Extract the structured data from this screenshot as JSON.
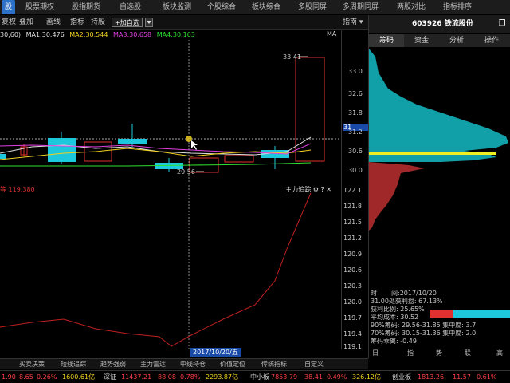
{
  "topnav": {
    "tabs": [
      "股",
      "股票期权",
      "股指期货",
      "自选股",
      "板块监测",
      "个股综合",
      "板块综合",
      "多股同屏",
      "多周期同屏",
      "两股对比",
      "指标排序"
    ],
    "active_index": 0
  },
  "toolbar": {
    "items": [
      "复权",
      "叠加",
      "画线",
      "指标",
      "持股"
    ],
    "add_label": "+加自选"
  },
  "ma_legend": {
    "params": "30,60)",
    "ma1": "MA1:30.476",
    "ma2": "MA2:30.544",
    "ma3": "MA3:30.658",
    "ma4": "MA4:30.163",
    "right": "MA",
    "colors": {
      "ma1": "#e0e0e0",
      "ma2": "#f0d020",
      "ma3": "#e040e0",
      "ma4": "#30e030"
    }
  },
  "price_annotations": {
    "high": "33.41",
    "low": "29.56"
  },
  "price_axis": {
    "crosshair": "31",
    "labels": [
      "33.0",
      "32.6",
      "32.2",
      "31.8",
      "31.4",
      "31.0",
      "30.6",
      "30.2",
      "29.8"
    ]
  },
  "indicator": {
    "left_label": "等 119.380",
    "right_label": "主力追踪",
    "axis": [
      "122.1",
      "121.8",
      "121.5",
      "121.2",
      "120.9",
      "120.6",
      "120.3",
      "120.0",
      "119.7",
      "119.4",
      "119.1"
    ]
  },
  "date_badge": "2017/10/20/五",
  "stock": {
    "title": "603926 铁流股份",
    "close": "❐"
  },
  "right_tabs": [
    "筹码",
    "资金",
    "分析",
    "操作"
  ],
  "chip_axis": {
    "labels": [
      "33.0",
      "32.6",
      "31.8",
      "31.2",
      "30.6",
      "30.0"
    ],
    "current": "31"
  },
  "chip_info": {
    "time_label": "时",
    "time_value": "间:2017/10/20",
    "close_profit": "31.00处获利盘: 67.13%",
    "profit_ratio": "获利比例: 25.65%",
    "avg_cost": "平均成本: 30.52",
    "chip90": "90%筹码: 29.56-31.85",
    "conc90": "集中度: 3.7",
    "chip70": "70%筹码: 30.15-31.36",
    "conc70": "集中度: 2.0",
    "chip_diff": "筹码乖离: -0.49"
  },
  "chip_bottom": [
    "日",
    "指",
    "势",
    "联",
    "高"
  ],
  "bottom_tabs": [
    "买卖决策",
    "短线追踪",
    "趋势强弱",
    "主力雷达",
    "中线持仓",
    "价值定位",
    "传统指标",
    "自定义"
  ],
  "ticker": [
    {
      "t": "1.90",
      "c": "r"
    },
    {
      "t": "8.65",
      "c": "r"
    },
    {
      "t": "0.26%",
      "c": "r"
    },
    {
      "t": "1600.61亿",
      "c": "y"
    },
    {
      "t": "深证",
      "c": "w"
    },
    {
      "t": "11437.21",
      "c": "r"
    },
    {
      "t": "88.08",
      "c": "r"
    },
    {
      "t": "0.78%",
      "c": "r"
    },
    {
      "t": "2293.87亿",
      "c": "y"
    },
    {
      "t": "中小板",
      "c": "w"
    },
    {
      "t": "7853.79",
      "c": "r"
    },
    {
      "t": "38.41",
      "c": "r"
    },
    {
      "t": "0.49%",
      "c": "r"
    },
    {
      "t": "326.12亿",
      "c": "y"
    },
    {
      "t": "创业板",
      "c": "w"
    },
    {
      "t": "1813.26",
      "c": "r"
    },
    {
      "t": "11.57",
      "c": "r"
    },
    {
      "t": "0.61%",
      "c": "r"
    }
  ]
}
